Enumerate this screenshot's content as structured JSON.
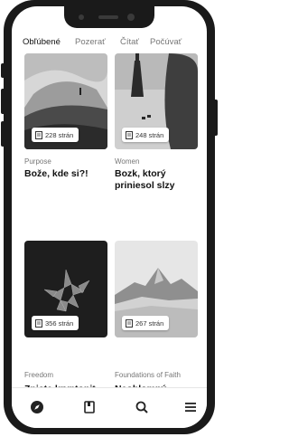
{
  "tabs": [
    {
      "label": "Obľúbené",
      "active": true
    },
    {
      "label": "Pozerať",
      "active": false
    },
    {
      "label": "Čítať",
      "active": false
    },
    {
      "label": "Počúvať",
      "active": false
    }
  ],
  "books": [
    {
      "category": "Purpose",
      "title": "Bože, kde si?!",
      "pages": "228 strán"
    },
    {
      "category": "Women",
      "title": "Bozk, ktorý priniesol slzy",
      "pages": "248 strán"
    },
    {
      "category": "Freedom",
      "title": "Znicte kryptonit",
      "pages": "356 strán"
    },
    {
      "category": "Foundations of Faith",
      "title": "Neoblomný",
      "pages": "267 strán"
    }
  ],
  "bottom_nav": {
    "icons": [
      "compass-icon",
      "book-icon",
      "search-icon",
      "menu-icon"
    ]
  }
}
